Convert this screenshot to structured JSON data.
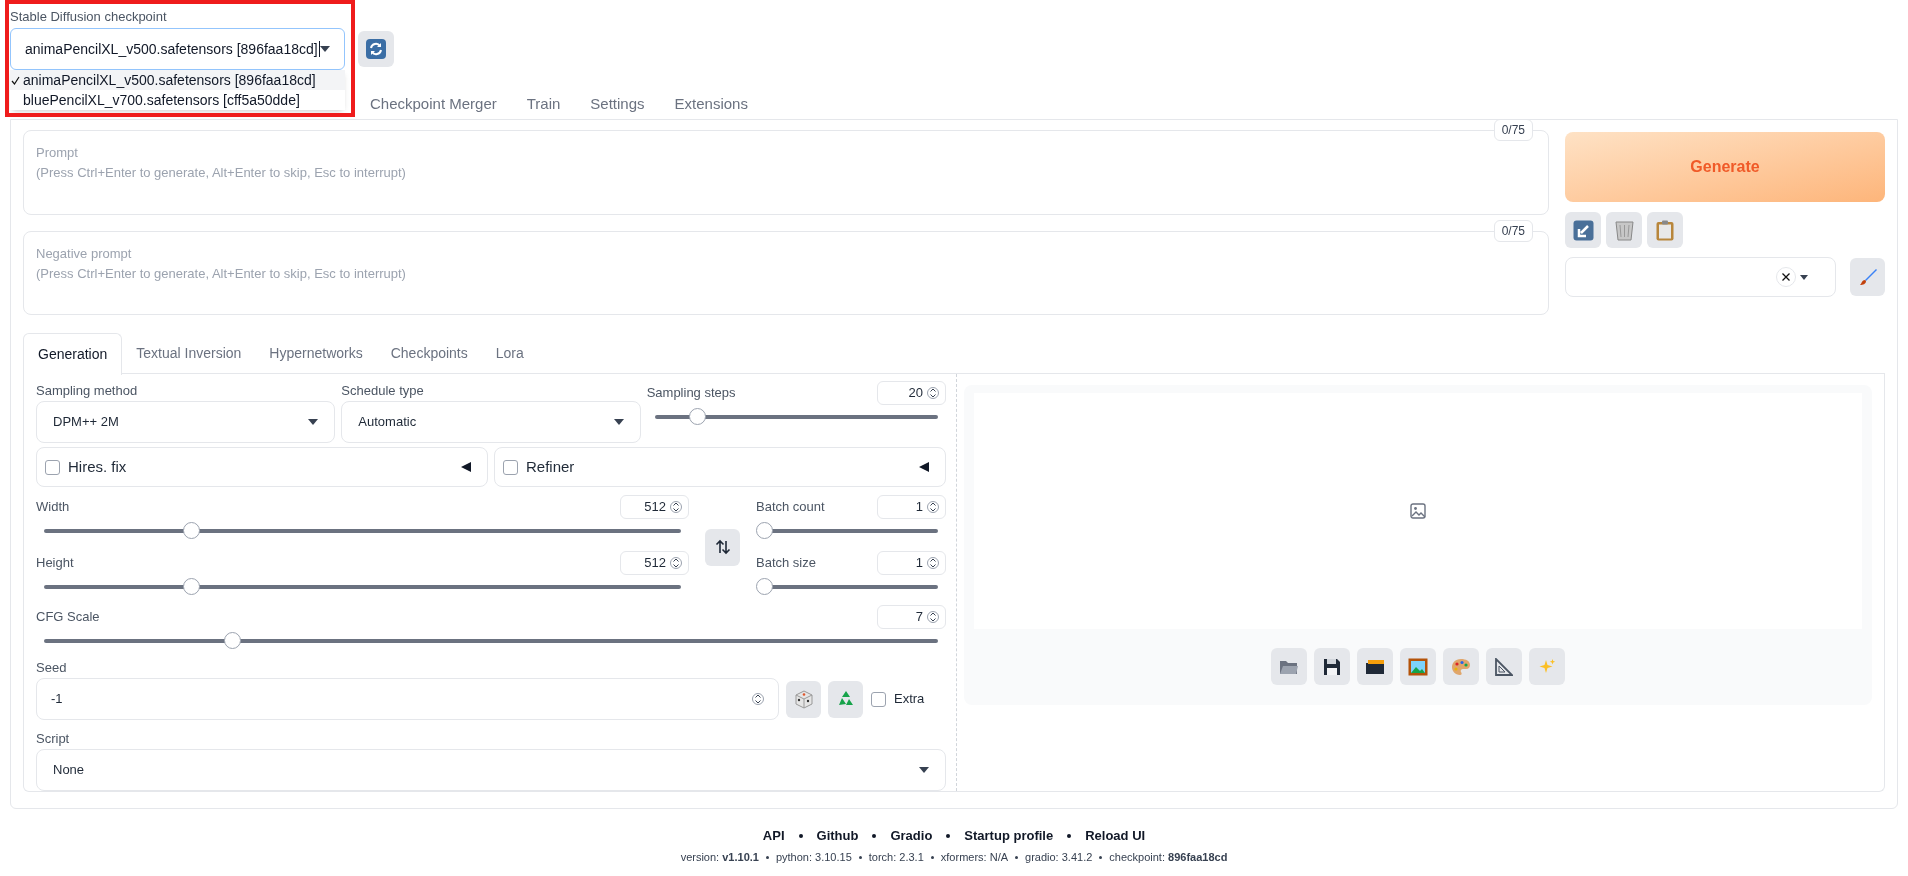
{
  "checkpoint": {
    "label": "Stable Diffusion checkpoint",
    "value": "animaPencilXL_v500.safetensors [896faa18cd]",
    "options": [
      {
        "label": "animaPencilXL_v500.safetensors [896faa18cd]",
        "selected": true
      },
      {
        "label": "bluePencilXL_v700.safetensors [cff5a50dde]",
        "selected": false
      }
    ]
  },
  "main_tabs": [
    {
      "label": "Checkpoint Merger",
      "selected": false
    },
    {
      "label": "Train",
      "selected": false
    },
    {
      "label": "Settings",
      "selected": false
    },
    {
      "label": "Extensions",
      "selected": false
    }
  ],
  "prompt": {
    "placeholder": "Prompt\n(Press Ctrl+Enter to generate, Alt+Enter to skip, Esc to interrupt)",
    "token_count": "0/75"
  },
  "negative_prompt": {
    "placeholder": "Negative prompt\n(Press Ctrl+Enter to generate, Alt+Enter to skip, Esc to interrupt)",
    "token_count": "0/75"
  },
  "generate_button": "Generate",
  "sub_tabs": [
    {
      "label": "Generation",
      "selected": true
    },
    {
      "label": "Textual Inversion",
      "selected": false
    },
    {
      "label": "Hypernetworks",
      "selected": false
    },
    {
      "label": "Checkpoints",
      "selected": false
    },
    {
      "label": "Lora",
      "selected": false
    }
  ],
  "sampling_method": {
    "label": "Sampling method",
    "value": "DPM++ 2M"
  },
  "schedule_type": {
    "label": "Schedule type",
    "value": "Automatic"
  },
  "sampling_steps": {
    "label": "Sampling steps",
    "value": "20",
    "level": 0.15
  },
  "accordions": [
    {
      "label": "Hires. fix",
      "checked": false
    },
    {
      "label": "Refiner",
      "checked": false
    }
  ],
  "width": {
    "label": "Width",
    "value": "512",
    "level": 0.23
  },
  "height": {
    "label": "Height",
    "value": "512",
    "level": 0.23
  },
  "batch_count": {
    "label": "Batch count",
    "value": "1",
    "level": 0
  },
  "batch_size": {
    "label": "Batch size",
    "value": "1",
    "level": 0
  },
  "cfg_scale": {
    "label": "CFG Scale",
    "value": "7",
    "level": 0.21
  },
  "seed": {
    "label": "Seed",
    "value": "-1"
  },
  "extra": {
    "label": "Extra",
    "checked": false
  },
  "script": {
    "label": "Script",
    "value": "None"
  },
  "footer": {
    "links": [
      "API",
      "Github",
      "Gradio",
      "Startup profile",
      "Reload UI"
    ],
    "versions": [
      "version: **v1.10.1**",
      "python: 3.10.15",
      "torch: 2.3.1",
      "xformers: N/A",
      "gradio: 3.41.2",
      "checkpoint: **896faa18cd**"
    ]
  }
}
